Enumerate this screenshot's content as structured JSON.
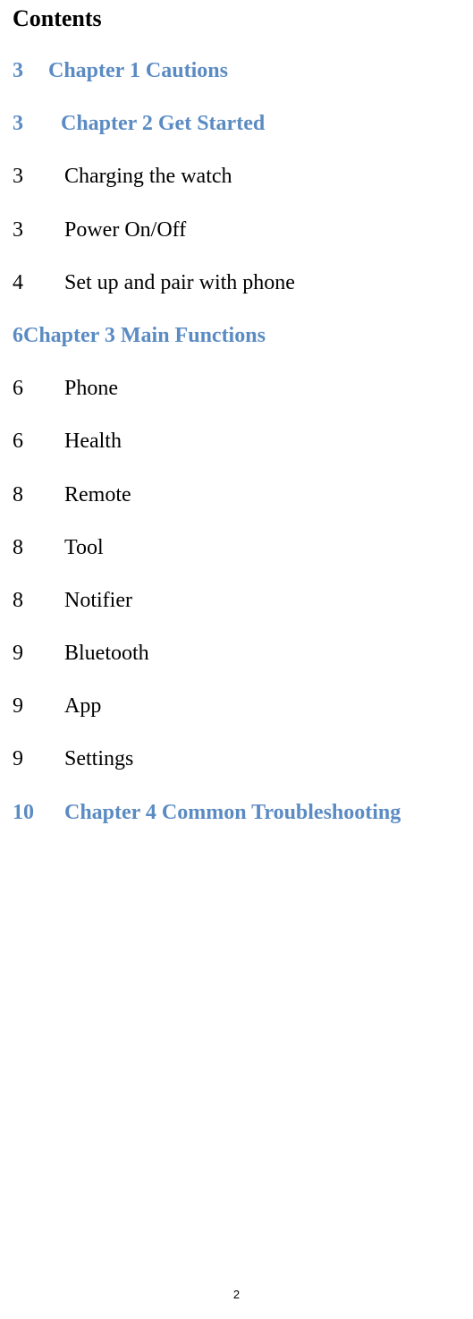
{
  "title": "Contents",
  "entries": [
    {
      "page": "3",
      "title": "Chapter 1 Cautions",
      "type": "chapter",
      "variant": "chapter1"
    },
    {
      "page": "3",
      "title": "Chapter 2 Get Started",
      "type": "chapter",
      "variant": "chapter2"
    },
    {
      "page": "3",
      "title": "Charging the watch",
      "type": "sub"
    },
    {
      "page": "3",
      "title": "Power On/Off",
      "type": "sub"
    },
    {
      "page": "4",
      "title": "Set up and pair with phone",
      "type": "sub"
    },
    {
      "page": "6",
      "title": "Chapter 3 Main Functions",
      "type": "chapter",
      "variant": "chapter3"
    },
    {
      "page": "6",
      "title": "Phone",
      "type": "sub"
    },
    {
      "page": "6",
      "title": "Health",
      "type": "sub"
    },
    {
      "page": "8",
      "title": "Remote",
      "type": "sub"
    },
    {
      "page": "8",
      "title": "Tool",
      "type": "sub"
    },
    {
      "page": "8",
      "title": "Notifier",
      "type": "sub"
    },
    {
      "page": "9",
      "title": "Bluetooth",
      "type": "sub"
    },
    {
      "page": "9",
      "title": "App",
      "type": "sub"
    },
    {
      "page": "9",
      "title": "Settings",
      "type": "sub"
    },
    {
      "page": "10",
      "title": "Chapter 4 Common Troubleshooting",
      "type": "chapter",
      "variant": "chapter4"
    }
  ],
  "footer": "2"
}
